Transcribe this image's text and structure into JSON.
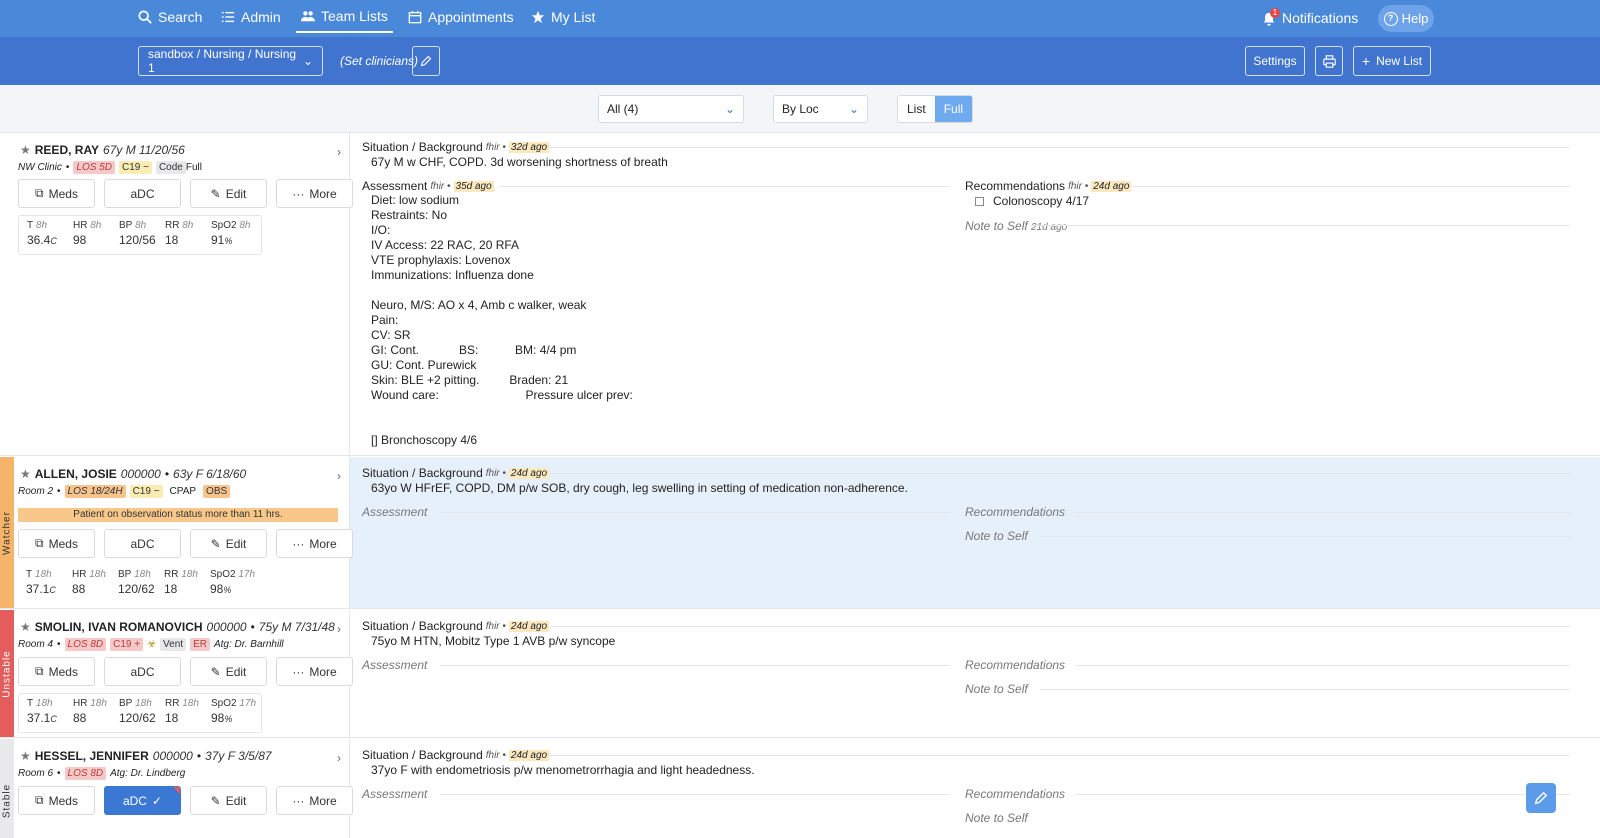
{
  "nav": {
    "search": "Search",
    "admin": "Admin",
    "team_lists": "Team Lists",
    "appointments": "Appointments",
    "my_list": "My List",
    "notifications": "Notifications",
    "notif_count": "1",
    "help": "Help"
  },
  "subbar": {
    "list_path": "sandbox / Nursing / Nursing 1",
    "set_clinicians": "(Set clinicians)",
    "settings": "Settings",
    "new_list": "New List"
  },
  "filters": {
    "group": "All (4)",
    "sort": "By Loc",
    "view_list": "List",
    "view_full": "Full"
  },
  "actions": {
    "meds": "Meds",
    "adc": "aDC",
    "edit": "Edit",
    "more": "More"
  },
  "labels": {
    "situation": "Situation / Background",
    "assessment": "Assessment",
    "recommendations": "Recommendations",
    "note_to_self": "Note to Self",
    "fhir": "fhir •"
  },
  "patients": [
    {
      "name": "REED, RAY",
      "mrn": "",
      "demo": "67y  M  11/20/56",
      "loc": "NW Clinic",
      "los": "LOS 5D",
      "c19": "C19 −",
      "code_label": "Code",
      "code": "Full",
      "status": "",
      "sb_ago": "32d ago",
      "situation": "67y M w CHF, COPD. 3d worsening shortness of breath",
      "assess_ago": "35d ago",
      "assessment": "Diet: low sodium\nRestraints: No\nI/O:\nIV Access: 22 RAC, 20 RFA\nVTE prophylaxis: Lovenox\nImmunizations: Influenza done\n\nNeuro, M/S: AO x 4, Amb c walker, weak\nPain:\nCV: SR\nGI: Cont.            BS:           BM: 4/4 pm\nGU: Cont. Purewick\nSkin: BLE +2 pitting.         Braden: 21\nWound care:                          Pressure ulcer prev:\n\n\n[] Bronchoscopy 4/6",
      "rec_ago": "24d ago",
      "rec_item": "Colonoscopy 4/17",
      "note_ago": "21d ago",
      "vitals": [
        {
          "k": "T",
          "t": "8h",
          "v": "36.4",
          "u": "C"
        },
        {
          "k": "HR",
          "t": "8h",
          "v": "98",
          "u": ""
        },
        {
          "k": "BP",
          "t": "8h",
          "v": "120/56",
          "u": ""
        },
        {
          "k": "RR",
          "t": "8h",
          "v": "18",
          "u": ""
        },
        {
          "k": "SpO2",
          "t": "8h",
          "v": "91",
          "u": "%"
        }
      ]
    },
    {
      "name": "ALLEN, JOSIE",
      "mrn": "000000",
      "demo": "63y  F  6/18/60",
      "loc": "Room 2",
      "los": "LOS 18/24H",
      "c19": "C19 −",
      "cpap": "CPAP",
      "obs": "OBS",
      "status": "Watcher",
      "warning": "Patient on observation status more than 11 hrs.",
      "sb_ago": "24d ago",
      "situation": "63yo W HFrEF, COPD, DM p/w SOB, dry cough, leg swelling in setting of medication non-adherence.",
      "vitals": [
        {
          "k": "T",
          "t": "18h",
          "v": "37.1",
          "u": "C"
        },
        {
          "k": "HR",
          "t": "18h",
          "v": "88",
          "u": ""
        },
        {
          "k": "BP",
          "t": "18h",
          "v": "120/62",
          "u": ""
        },
        {
          "k": "RR",
          "t": "18h",
          "v": "18",
          "u": ""
        },
        {
          "k": "SpO2",
          "t": "17h",
          "v": "98",
          "u": "%"
        }
      ]
    },
    {
      "name": "SMOLIN, IVAN ROMANOVICH",
      "mrn": "000000",
      "demo": "75y  M  7/31/48",
      "loc": "Room 4",
      "los": "LOS 8D",
      "c19": "C19 +",
      "vent": "Vent",
      "er": "ER",
      "attending": "Atg: Dr. Barnhill",
      "status": "Unstable",
      "sb_ago": "24d ago",
      "situation": "75yo M HTN, Mobitz Type 1 AVB p/w syncope",
      "vitals": [
        {
          "k": "T",
          "t": "18h",
          "v": "37.1",
          "u": "C"
        },
        {
          "k": "HR",
          "t": "18h",
          "v": "88",
          "u": ""
        },
        {
          "k": "BP",
          "t": "18h",
          "v": "120/62",
          "u": ""
        },
        {
          "k": "RR",
          "t": "18h",
          "v": "18",
          "u": ""
        },
        {
          "k": "SpO2",
          "t": "17h",
          "v": "98",
          "u": "%"
        }
      ]
    },
    {
      "name": "HESSEL, JENNIFER",
      "mrn": "000000",
      "demo": "37y  F  3/5/87",
      "loc": "Room 6",
      "los": "LOS 8D",
      "attending": "Atg: Dr. Lindberg",
      "status": "Stable",
      "sb_ago": "24d ago",
      "situation": "37yo F with endometriosis p/w menometrorrhagia and light headedness."
    }
  ],
  "colors": {
    "nav": "#4a88d9",
    "subbar": "#4174ce",
    "watcher": "#f6b46b",
    "unstable": "#e35d5d",
    "stable": "#e9e9eb",
    "row_highlight": "#e6f0fb"
  }
}
